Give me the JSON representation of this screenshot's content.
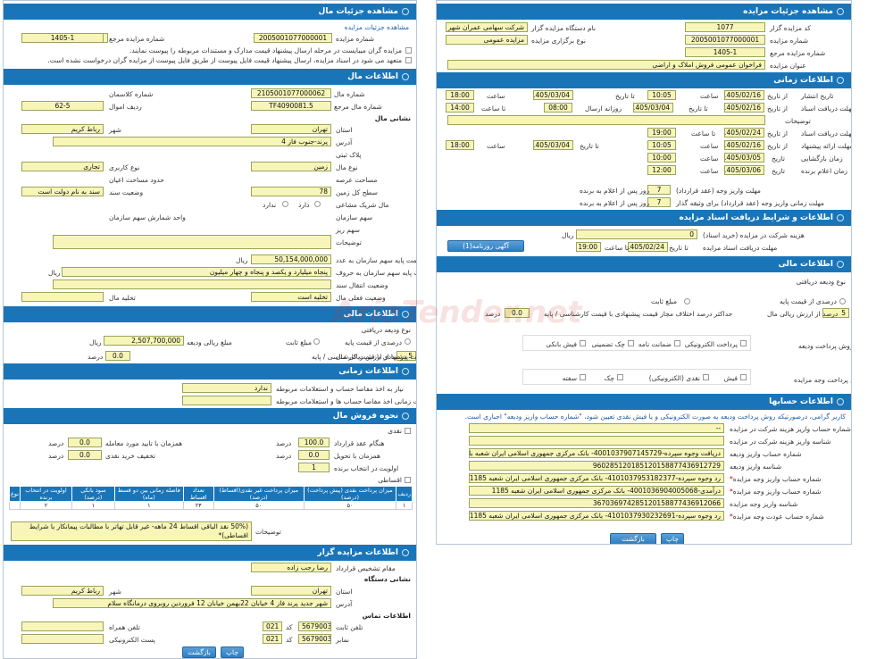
{
  "left": {
    "h_details": "مشاهده جزئیات مال",
    "link_details": "مشاهده جزئیات مزایده",
    "ref_label": "شماره مزایده مرجع",
    "ref_value": "1405-1",
    "auction_no_label": "شماره مزایده",
    "auction_no_value": "2005001077000001",
    "note1": "مزایده گران میبایست در مرحله ارسال پیشنهاد قیمت مدارک و مستندات مربوطه را پیوست نمایند.",
    "note2": "متعهد می شود در اسناد مزایده، ارسال پیشنهاد قیمت فایل پیوست از طریق فایل پیوست از مزایده گران درخواست نشده است.",
    "h_prop": "اطلاعات مال",
    "prop_no_label": "شماره مال",
    "prop_no_value": "2105001077000062",
    "class_no_label": "شماره کلاسمان",
    "prop_ref_label": "شماره مال مرجع",
    "prop_ref_value": "TF4090081.5",
    "row_label": "ردیف اموال",
    "row_value": "62-5",
    "addr_h": "نشانی مال",
    "province_label": "استان",
    "province_value": "تهران",
    "city_label": "شهر",
    "city_value": "رباط کریم",
    "address_label": "آدرس",
    "address_value": "پرند-جنوب فاز 4",
    "plate_label": "پلاک ثبتی",
    "prop_type_label": "نوع مال",
    "prop_type_value": "زمین",
    "usage_label": "نوع کاربری",
    "usage_value": "تجاری",
    "area_label": "مساحت عرصه",
    "bounds_label": "حدود مساحت اعیان",
    "land_label": "سطح کل زمین",
    "land_value": "78",
    "doc_label": "وضعیت سند",
    "doc_value": "سند به نام دولت است",
    "shared_label": "مال شریک مشاعی",
    "shared_opt_yes": "دارد",
    "shared_opt_no": "ندارد",
    "share_org_label": "سهم سازمان",
    "org_unit_label": "واحد شمارش سهم سازمان",
    "share_small_label": "سهم ریز",
    "desc_label": "توضیحات",
    "base_price_label": "قیمت پایه سهم سازمان به عدد",
    "base_price_value": "50,154,000,000",
    "rial": "ریال",
    "base_words_label": "قیمت پایه سهم سازمان به حروف",
    "base_words_value": "پنجاه میلیارد و یکصد و پنجاه و چهار میلیون",
    "transfer_label": "وضعیت انتقال سند",
    "current_label": "وضعیت فعلی مال",
    "current_value": "تخلیه است",
    "evict_label": "تخلیه مال",
    "h_fin": "اطلاعات مالی",
    "deposit_type": "نوع ودیعه دریافتی",
    "pct_base": "درصدی از قیمت پایه",
    "fixed": "مبلغ ثابت",
    "deposit_amount_label": "مبلغ ریالی ودیعه",
    "deposit_amount_value": "2,507,700,000",
    "pct_label": "درصد از ارزش ریالی مال",
    "pct_value": "5",
    "pct_unit": "درصد",
    "max_diff_label": "حداکثر درصد اختلاف مجاز قیمت پیشنهادی با قیمت کارشناسی / پایه",
    "max_diff_value": "0.0",
    "h_time": "اطلاعات زمانی",
    "need_acc_label": "نیاز به اخذ مفاصا حساب و استعلامات مربوطه",
    "need_acc_value": "ندارد",
    "deadline_acc_label": "مهلت زمانی اخذ مفاصا حساب ها و استعلامات مربوطه",
    "h_sale": "نحوه فروش مال",
    "cash": "نقدی",
    "contract_label": "هنگام عقد قرارداد",
    "contract_value": "100.0",
    "along_label": "همزمان با تایید مورد معامله",
    "along_value": "0.0",
    "wire_label": "همزمان با تحویل",
    "wire_value": "0.0",
    "cash_disc_label": "تخفیف خرید نقدی",
    "cash_disc_value": "0.0",
    "priority_label": "اولویت در انتخاب برنده",
    "priority_value": "1",
    "install_label": "اقساطی",
    "table_headers": [
      "ردیف",
      "میزان پرداخت نقدی (پیش پرداخت) (درصد)",
      "میزان پرداخت غیر نقدی(اقساط) (درصد)",
      "تعداد اقساط",
      "فاصله زمانی بین دو قسط (ماه)",
      "سود بانکی (درصد)",
      "اولویت در انتخاب برنده",
      "نوع"
    ],
    "table_row": [
      "۱",
      "۵۰",
      "۵۰",
      "۲۴",
      "۱",
      "۱",
      "۲",
      ""
    ],
    "explain_label": "توضیحات",
    "explain_value": "(50% نقد الباقی اقساط 24 ماهه- غیر قابل تهاتر با مطالبات پیمانکار با شرایط اقساطی)*\n(اولویت با پیشنهاد نقدی و قابل تهاتر با مطالبات پیمانکار)",
    "h_org": "اطلاعات مزایده گزار",
    "officer_label": "مقام تشخیص قرارداد",
    "officer_value": "رضا رجب زاده",
    "device_addr_h": "نشانی دستگاه",
    "dprovince_label": "استان",
    "dprovince_value": "تهران",
    "dcity_label": "شهر",
    "dcity_value": "رباط کریم",
    "daddress_label": "آدرس",
    "daddress_value": "شهر جدید پرند فاز 4 خیابان 22بهمن خیابان 12 فروردین روبروی درمانگاه سلام",
    "contact_h": "اطلاعات تماس",
    "phone_label": "تلفن ثابت",
    "phone_value": "56790038",
    "code_label": "کد",
    "code_value": "021",
    "mobile_label": "تلفن همراه",
    "fax_label": "نمابر",
    "fax_value": "56790030",
    "fax_code": "021",
    "email_label": "پست الکترونیکی",
    "print_btn": "چاپ",
    "back_btn": "بازگشت"
  },
  "right": {
    "h_details": "مشاهده جزئیات مزایده",
    "org_code_label": "کد مزایده گزار",
    "org_code_value": "1077",
    "org_name_label": "نام دستگاه مزایده گزار",
    "org_name_value": "شرکت سهامی عمران شهر",
    "auction_no_label": "شماره مزایده",
    "auction_no_value": "2005001077000001",
    "hold_type_label": "نوع برگزاری مزایده",
    "hold_type_value": "مزایده عمومی",
    "ref_label": "شماره مزایده مرجع",
    "ref_value": "1405-1",
    "title_label": "عنوان مزایده",
    "title_value": "فراخوان عمومی فروش املاک و اراضی",
    "h_time": "اطلاعات زمانی",
    "pub_label": "تاریخ انتشار",
    "doc_label": "مهلت دریافت اسناد",
    "desc_label": "توضیحات",
    "recv_label": "مهلت دریافت اسناد",
    "offer_label": "مهلت ارائه پیشنهاد",
    "open_label": "زمان بازگشایی",
    "announce_label": "زمان اعلام برنده",
    "from": "از تاریخ",
    "to": "تا تاریخ",
    "time": "ساعت",
    "date": "تاریخ",
    "to_time": "تا ساعت",
    "sel_days": "روزانه ارسال",
    "pub_from": "1405/02/16",
    "pub_time": "10:05",
    "pub_to": "1405/03/04",
    "pub_to_time": "18:00",
    "doc_from": "1405/02/16",
    "doc_time": "10:05",
    "doc_to": "1405/03/04",
    "doc_mid": "08:00",
    "doc_to_time": "14:00",
    "recv_from": "1405/02/24",
    "recv_time": "19:00",
    "offer_from": "1405/02/16",
    "offer_time": "10:05",
    "offer_to": "1405/03/04",
    "offer_to_time": "18:00",
    "open_date": "1405/03/05",
    "open_time": "10:00",
    "ann_date": "1405/03/06",
    "ann_time": "12:00",
    "pay_deadline_label": "مهلت واریز وجه (عقد قرارداد)",
    "pay_deadline_value": "7",
    "pay_deadline_unit": "روز پس از اعلام به برنده",
    "guar_label": "مهلت زمانی واریز وجه (عقد قرارداد) برای وثیقه گذار",
    "guar_value": "7",
    "guar_unit": "روز پس از اعلام به برنده",
    "h_terms": "اطلاعات و شرایط دریافت اسناد مزایده",
    "fee_label": "هزینه شرکت در مزایده (خرید اسناد)",
    "fee_value": "0",
    "rial": "ریال",
    "doc_recv_label": "مهلت دریافت اسناد مزایده",
    "doc_recv_from": "1405/02/24",
    "doc_recv_time": "19:00",
    "newspaper_btn": "آگهی روزنامه(1)",
    "h_fin": "اطلاعات مالی",
    "deposit_type": "نوع ودیعه دریافتی",
    "pct_base": "درصدی از قیمت پایه",
    "fixed": "مبلغ ثابت",
    "pct_label": "درصد از ارزش ریالی مال",
    "pct_value": "5",
    "max_diff_label": "حداکثر درصد اختلاف مجاز قیمت پیشنهادی با قیمت کارشناسی / پایه",
    "max_diff_value": "0.0",
    "pct_unit": "درصد",
    "pay_dep_label": "روش پرداخت ودیعه",
    "pay_dep_opts": [
      "پرداخت الکترونیکی",
      "ضمانت نامه",
      "چک تضمینی",
      "فیش بانکی"
    ],
    "pay_amt_label": "روش پرداخت وجه مزایده",
    "pay_amt_opts": [
      "فیش",
      "نقدی (الکترونیکی)",
      "چک",
      "سفته"
    ],
    "h_acc": "اطلاعات حسابها",
    "acc_note": "کاربر گرامی، درصورتیکه روش پرداخت ودیعه به صورت الکترونیکی و یا فیش نقدی تعیین شود، \"شماره حساب واریز ودیعه\" اجباری است.",
    "fee_acc_label": "شماره حساب واریز هزینه شرکت در مزایده",
    "fee_acc_value": "--",
    "fee_id_label": "شناسه واریز هزینه شرکت در مزایده",
    "dep_acc_label": "شماره حساب واریز ودیعه",
    "dep_acc_value": "دریافت وجوه سپرده-4001037907145729- بانک مرکزی جمهوری اسلامی ایران شعبه بانک",
    "dep_id_label": "شناسه واریز ودیعه",
    "dep_id_value": "960285120185120158877436912729",
    "pay_acc_label": "شماره حساب واریز وجه مزایده",
    "pay_acc_value": "رد وجوه سپرده-4101037953182377- بانک مرکزی جمهوری اسلامی ایران شعبه 1185",
    "pay_acc2_label": "شماره حساب واریز وجه مزایده",
    "pay_acc2_value": "درآمدی-4001036904005068- بانک مرکزی جمهوری اسلامی ایران شعبه 1185",
    "pay_id_label": "شناسه واریز وجه مزایده",
    "pay_id_value": "367036974285120158877436912066",
    "ret_acc_label": "شماره حساب عودت وجه مزایده",
    "ret_acc_value": "رد وجوه سپرده-4101037930232691- بانک مرکزی جمهوری اسلامی ایران شعبه 1185",
    "print_btn": "چاپ",
    "back_btn": "بازگشت"
  },
  "watermark": "AriaTender.net"
}
